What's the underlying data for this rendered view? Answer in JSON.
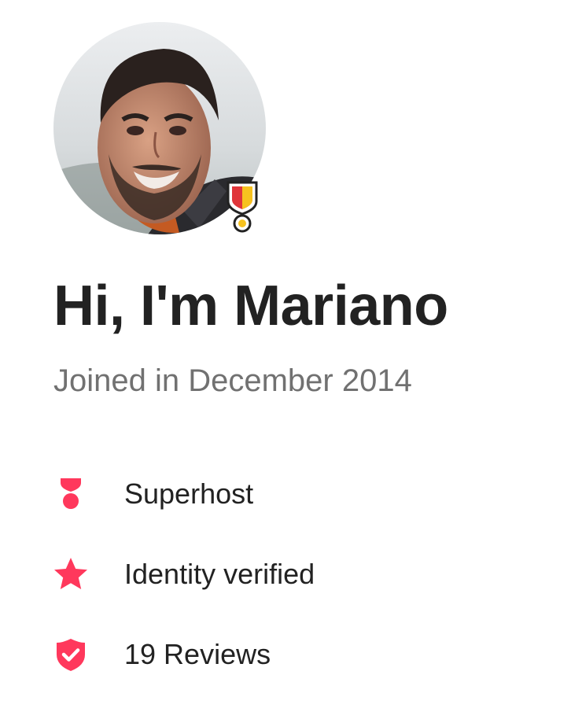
{
  "profile": {
    "greeting": "Hi, I'm Mariano",
    "joined": "Joined in December 2014",
    "avatar_icon": "profile-photo",
    "badge_icon": "superhost-medal-icon"
  },
  "stats": [
    {
      "icon": "superhost-medal-icon",
      "label": "Superhost"
    },
    {
      "icon": "star-icon",
      "label": "Identity verified"
    },
    {
      "icon": "shield-check-icon",
      "label": "19 Reviews"
    }
  ],
  "colors": {
    "accent": "#FF385C",
    "text_primary": "#222222",
    "text_secondary": "#717171",
    "badge_gold": "#E8B900",
    "badge_red": "#E0353A"
  }
}
